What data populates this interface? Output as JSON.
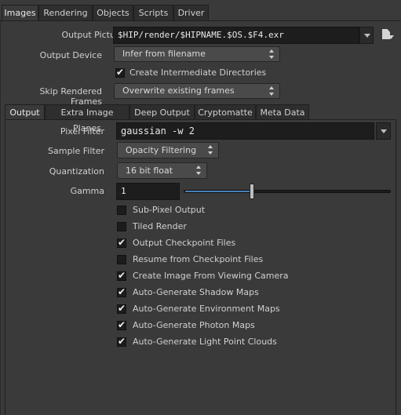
{
  "top_tabs": [
    {
      "label": "Images",
      "active": true
    },
    {
      "label": "Rendering",
      "active": false
    },
    {
      "label": "Objects",
      "active": false
    },
    {
      "label": "Scripts",
      "active": false
    },
    {
      "label": "Driver",
      "active": false
    }
  ],
  "output_picture": {
    "label": "Output Picture",
    "value": "$HIP/render/$HIPNAME.$OS.$F4.exr"
  },
  "output_device": {
    "label": "Output Device",
    "value": "Infer from filename"
  },
  "create_dirs": {
    "label": "Create Intermediate Directories",
    "checked": true
  },
  "skip_rendered": {
    "label": "Skip Rendered Frames",
    "value": "Overwrite existing frames"
  },
  "sub_tabs": [
    {
      "label": "Output",
      "active": true
    },
    {
      "label": "Extra Image Planes",
      "active": false
    },
    {
      "label": "Deep Output",
      "active": false
    },
    {
      "label": "Cryptomatte",
      "active": false
    },
    {
      "label": "Meta Data",
      "active": false
    }
  ],
  "pixel_filter": {
    "label": "Pixel Filter",
    "value": "gaussian -w 2"
  },
  "sample_filter": {
    "label": "Sample Filter",
    "value": "Opacity Filtering"
  },
  "quantization": {
    "label": "Quantization",
    "value": "16 bit float"
  },
  "gamma": {
    "label": "Gamma",
    "value": "1",
    "slider_fraction": 0.33
  },
  "checkboxes": [
    {
      "label": "Sub-Pixel Output",
      "checked": false
    },
    {
      "label": "Tiled Render",
      "checked": false
    },
    {
      "label": "Output Checkpoint Files",
      "checked": true
    },
    {
      "label": "Resume from Checkpoint Files",
      "checked": false
    },
    {
      "label": "Create Image From Viewing Camera",
      "checked": true
    },
    {
      "label": "Auto-Generate Shadow Maps",
      "checked": true
    },
    {
      "label": "Auto-Generate Environment Maps",
      "checked": true
    },
    {
      "label": "Auto-Generate Photon Maps",
      "checked": true
    },
    {
      "label": "Auto-Generate Light Point Clouds",
      "checked": true
    }
  ],
  "icons": {
    "file_chooser": "file-chooser-icon",
    "dropdown": "chevron-down-icon",
    "menu_arrows": "up-down-arrows-icon",
    "check": "check-icon"
  },
  "colors": {
    "background": "#3a3a3a",
    "field": "#1d1d1d",
    "slider_fill": "#4a7fb5"
  }
}
